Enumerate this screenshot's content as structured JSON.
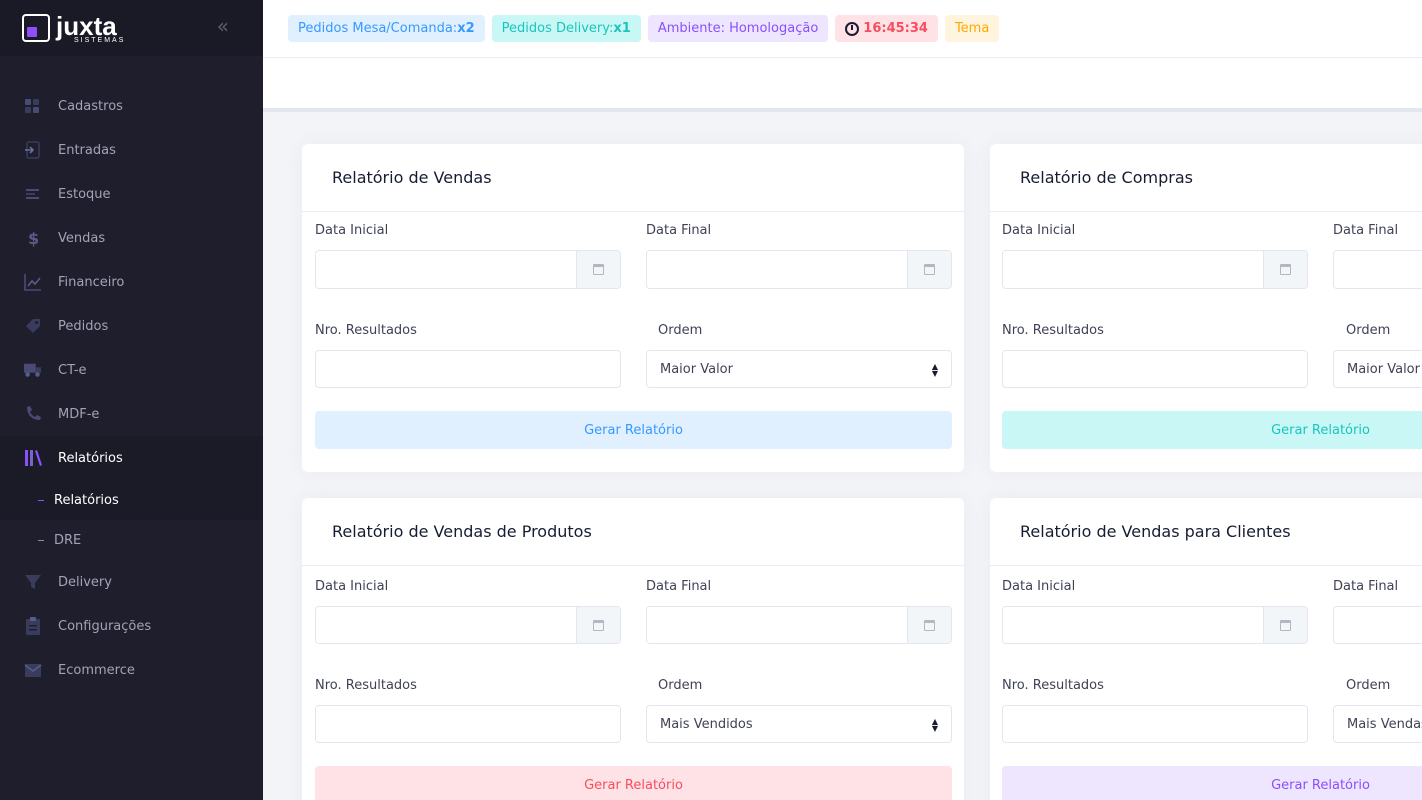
{
  "brand": {
    "name": "juxta",
    "sub": "SISTEMAS"
  },
  "sidebar": {
    "collapse_icon": "«",
    "items": [
      {
        "label": "Cadastros",
        "icon": "grid-icon"
      },
      {
        "label": "Entradas",
        "icon": "sign-in-icon"
      },
      {
        "label": "Estoque",
        "icon": "list-icon"
      },
      {
        "label": "Vendas",
        "icon": "dollar-icon"
      },
      {
        "label": "Financeiro",
        "icon": "chart-line-icon"
      },
      {
        "label": "Pedidos",
        "icon": "tag-icon"
      },
      {
        "label": "CT-e",
        "icon": "truck-icon"
      },
      {
        "label": "MDF-e",
        "icon": "phone-icon"
      },
      {
        "label": "Relatórios",
        "icon": "library-icon"
      }
    ],
    "sub_items": [
      {
        "label": "Relatórios"
      },
      {
        "label": "DRE"
      }
    ],
    "items_after": [
      {
        "label": "Delivery",
        "icon": "filter-icon"
      },
      {
        "label": "Configurações",
        "icon": "clipboard-icon"
      },
      {
        "label": "Ecommerce",
        "icon": "mail-icon"
      }
    ]
  },
  "header": {
    "mesa_label": "Pedidos Mesa/Comanda:",
    "mesa_count": "x2",
    "delivery_label": "Pedidos Delivery:",
    "delivery_count": "x1",
    "ambiente": "Ambiente: Homologação",
    "time": "16:45:34",
    "tema": "Tema"
  },
  "cards": [
    {
      "title": "Relatório de Vendas",
      "data_inicial": "Data Inicial",
      "data_final": "Data Final",
      "nro": "Nro. Resultados",
      "ordem": "Ordem",
      "ordem_value": "Maior Valor",
      "button": "Gerar Relatório"
    },
    {
      "title": "Relatório de Compras",
      "data_inicial": "Data Inicial",
      "data_final": "Data Final",
      "nro": "Nro. Resultados",
      "ordem": "Ordem",
      "ordem_value": "Maior Valor",
      "button": "Gerar Relatório"
    },
    {
      "title": "Relatório de Vendas de Produtos",
      "data_inicial": "Data Inicial",
      "data_final": "Data Final",
      "nro": "Nro. Resultados",
      "ordem": "Ordem",
      "ordem_value": "Mais Vendidos",
      "button": "Gerar Relatório"
    },
    {
      "title": "Relatório de Vendas para Clientes",
      "data_inicial": "Data Inicial",
      "data_final": "Data Final",
      "nro": "Nro. Resultados",
      "ordem": "Ordem",
      "ordem_value": "Mais Vendas",
      "button": "Gerar Relatório"
    }
  ]
}
